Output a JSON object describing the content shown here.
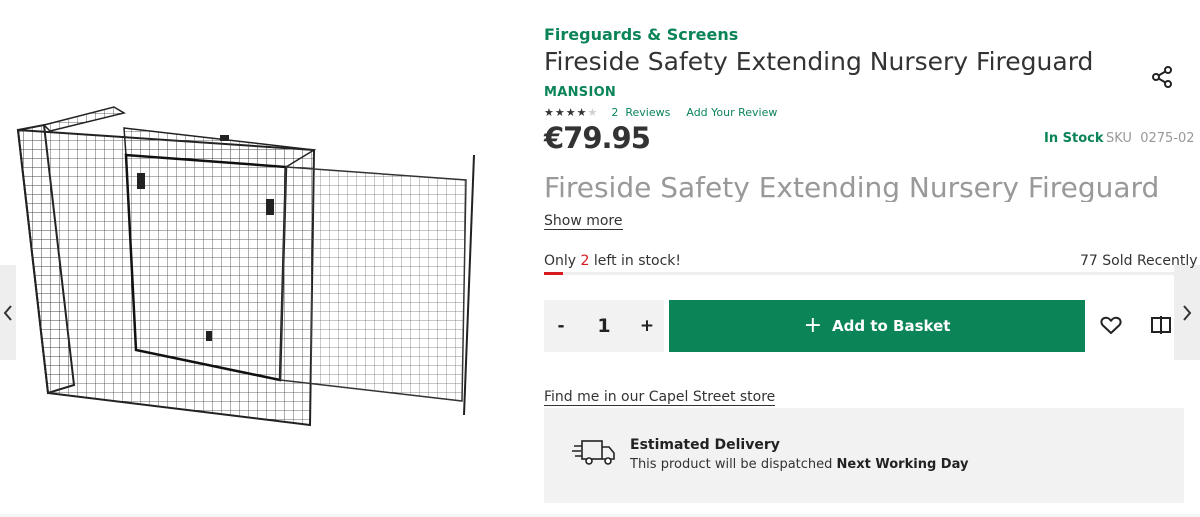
{
  "product": {
    "category": "Fireguards & Screens",
    "title": "Fireside Safety Extending Nursery Fireguard",
    "brand": "MANSION",
    "rating_stars": 3.5,
    "rating_max": 5,
    "reviews_count": "2",
    "reviews_label": "Reviews",
    "add_review": "Add Your Review",
    "price": "€79.95",
    "stock_status": "In Stock",
    "sku_label": "SKU",
    "sku": "0275-02",
    "description_preview": "Fireside Safety Extending Nursery Fireguard",
    "show_more": "Show more"
  },
  "scarcity": {
    "prefix": "Only",
    "count": "2",
    "suffix": "left in stock!",
    "sold_recently": "77 Sold Recently",
    "stock_level_fraction": 0.03
  },
  "purchase": {
    "minus": "-",
    "quantity": "1",
    "plus": "+",
    "add_plus_glyph": "+",
    "add_to_basket": "Add to Basket"
  },
  "store": {
    "link": "Find me in our Capel Street store"
  },
  "delivery": {
    "title": "Estimated Delivery",
    "text_prefix": "This product will be dispatched",
    "text_bold": "Next Working Day"
  },
  "icons": {
    "share": "share-icon",
    "wishlist": "heart-icon",
    "compare": "compare-icon",
    "delivery": "truck-icon",
    "prev": "chevron-left-icon",
    "next": "chevron-right-icon"
  },
  "colors": {
    "brand_green": "#0b8457",
    "alert_red": "#d71920",
    "panel_grey": "#f2f2f2"
  }
}
